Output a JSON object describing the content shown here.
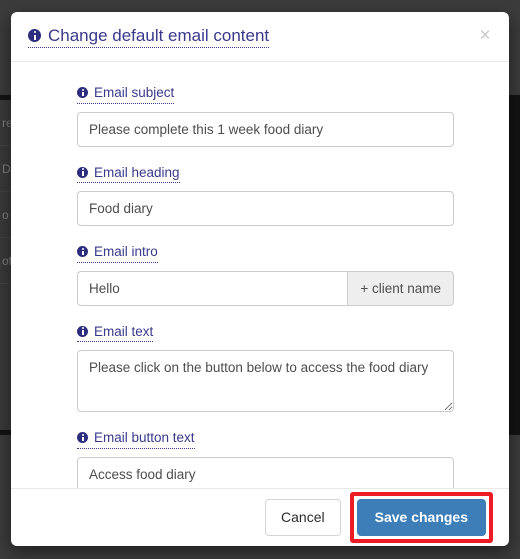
{
  "backdrop": {
    "rows": [
      "re",
      "Di",
      "o",
      "of"
    ]
  },
  "modal": {
    "title": "Change default email content",
    "title_icon": "info-circle-icon",
    "close_label": "×",
    "fields": [
      {
        "label": "Email subject",
        "icon": "info-circle-icon",
        "type": "text",
        "value": "Please complete this 1 week food diary",
        "placeholder": ""
      },
      {
        "label": "Email heading",
        "icon": "info-circle-icon",
        "type": "text",
        "value": "Food diary",
        "placeholder": ""
      },
      {
        "label": "Email intro",
        "icon": "info-circle-icon",
        "type": "input-group",
        "value": "Hello",
        "placeholder": "",
        "append_label": "+ client name"
      },
      {
        "label": "Email text",
        "icon": "info-circle-icon",
        "type": "textarea",
        "value": "Please click on the button below to access the food diary",
        "placeholder": ""
      },
      {
        "label": "Email button text",
        "icon": "info-circle-icon",
        "type": "text",
        "value": "Access food diary",
        "placeholder": ""
      }
    ],
    "footer": {
      "cancel_label": "Cancel",
      "save_label": "Save changes"
    }
  },
  "colors": {
    "label": "#39398c",
    "primary_button": "#3d7eb8",
    "highlight": "#ed1c24",
    "backdrop": "#3c3c3c"
  }
}
